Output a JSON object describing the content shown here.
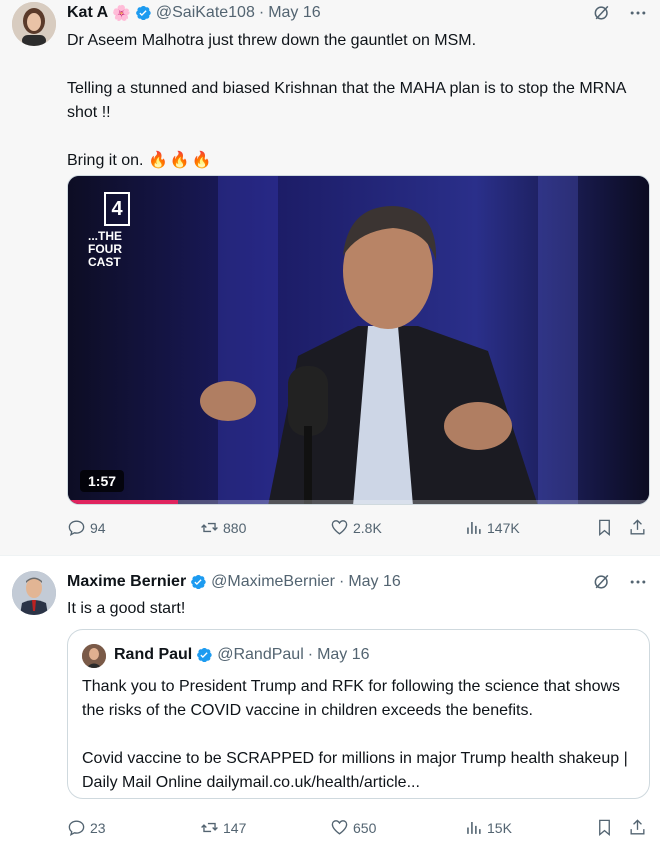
{
  "tweets": [
    {
      "author": "Kat A",
      "flower": "🌸",
      "handle": "@SaiKate108",
      "date": "May 16",
      "text": [
        "Dr Aseem Malhotra just threw down the gauntlet on MSM.",
        "",
        "Telling a stunned and biased Krishnan that the MAHA plan is to stop the MRNA shot !!",
        "",
        "Bring it on."
      ],
      "emoji": "🔥🔥🔥",
      "video": {
        "duration": "1:57",
        "channel_logo": "4",
        "show_title": "...THE FOUR CAST",
        "progress": 0.19
      },
      "stats": {
        "replies": "94",
        "reposts": "880",
        "likes": "2.8K",
        "views": "147K"
      }
    },
    {
      "author": "Maxime Bernier",
      "handle": "@MaximeBernier",
      "date": "May 16",
      "text": "It is a good start!",
      "quote": {
        "author": "Rand Paul",
        "handle": "@RandPaul",
        "date": "May 16",
        "text": [
          "Thank you to President Trump and RFK for following the science that shows the risks of the COVID vaccine in children exceeds the benefits.",
          "",
          "Covid vaccine to be SCRAPPED for millions in major Trump health shakeup | Daily Mail Online dailymail.co.uk/health/article..."
        ]
      },
      "stats": {
        "replies": "23",
        "reposts": "147",
        "likes": "650",
        "views": "15K"
      }
    }
  ],
  "colors": {
    "verified": "#1d9bf0",
    "meta": "#536471",
    "accent_progress": "#e0245e",
    "card_bg": "#f7f7f7"
  }
}
